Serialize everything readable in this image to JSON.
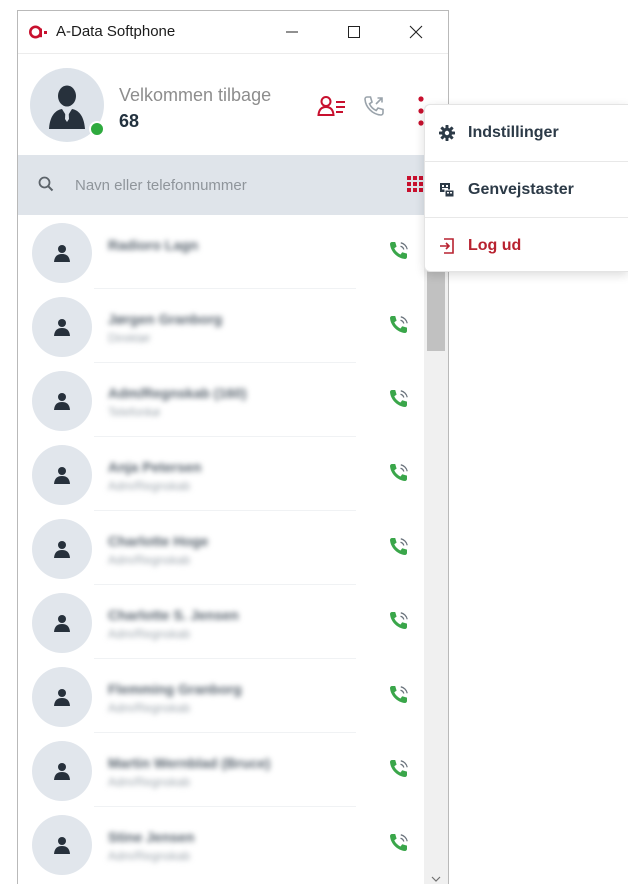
{
  "window": {
    "title": "A-Data Softphone",
    "controls": {
      "minimize": "minimize-icon",
      "maximize": "maximize-icon",
      "close": "close-icon"
    }
  },
  "header": {
    "welcome_text": "Velkommen tilbage",
    "extension": "68",
    "status": "online",
    "status_color": "#2eaa3e",
    "icons": [
      "contacts-list-icon",
      "call-history-icon",
      "more-vertical-icon"
    ]
  },
  "search": {
    "placeholder": "Navn eller telefonnummer",
    "value": ""
  },
  "contacts": [
    {
      "name": "Radioro Lagn",
      "subtitle": ""
    },
    {
      "name": "Jørgen Granborg",
      "subtitle": "Direktør"
    },
    {
      "name": "Adm/Regnskab (160)",
      "subtitle": "Telefonkø"
    },
    {
      "name": "Anja Petersen",
      "subtitle": "Adm/Regnskab"
    },
    {
      "name": "Charlotte Hoge",
      "subtitle": "Adm/Regnskab"
    },
    {
      "name": "Charlotte S. Jensen",
      "subtitle": "Adm/Regnskab"
    },
    {
      "name": "Flemming Granborg",
      "subtitle": "Adm/Regnskab"
    },
    {
      "name": "Martin Wernblad (Bruce)",
      "subtitle": "Adm/Regnskab"
    },
    {
      "name": "Stine Jensen",
      "subtitle": "Adm/Regnskab"
    }
  ],
  "menu": {
    "items": [
      {
        "label": "Indstillinger",
        "icon": "settings-gear-icon"
      },
      {
        "label": "Genvejstaster",
        "icon": "keyboard-shortcuts-icon"
      },
      {
        "label": "Log ud",
        "icon": "logout-icon"
      }
    ]
  },
  "colors": {
    "accent_red": "#c8102e",
    "call_green": "#3aa64a",
    "search_bg": "#dfe4ea",
    "text_dark": "#23323f"
  }
}
